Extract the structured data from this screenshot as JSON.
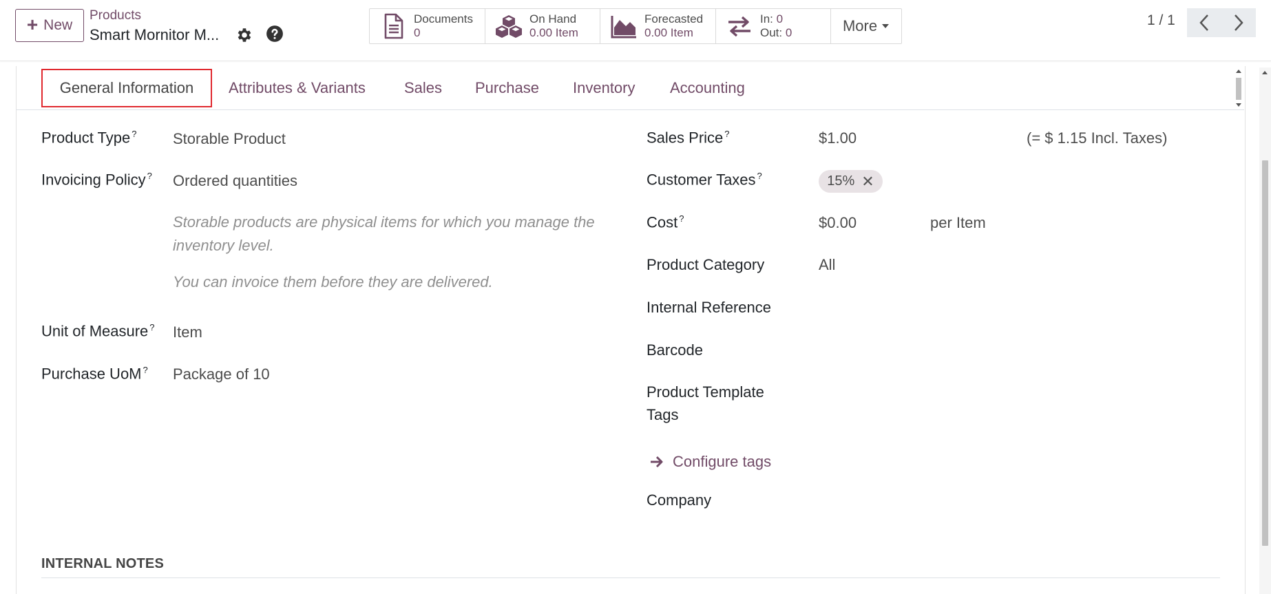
{
  "control_panel": {
    "new_label": "New",
    "breadcrumb_parent": "Products",
    "breadcrumb_current": "Smart Mornitor M...",
    "smart_buttons": {
      "documents": {
        "label": "Documents",
        "value": "0"
      },
      "on_hand": {
        "label": "On Hand",
        "value": "0.00 Item"
      },
      "forecasted": {
        "label": "Forecasted",
        "value": "0.00 Item"
      },
      "in_label": "In:",
      "in_value": "0",
      "out_label": "Out:",
      "out_value": "0",
      "more_label": "More"
    },
    "pager": "1 / 1"
  },
  "tabs": [
    "General Information",
    "Attributes & Variants",
    "Sales",
    "Purchase",
    "Inventory",
    "Accounting"
  ],
  "left_fields": {
    "product_type": {
      "label": "Product Type",
      "value": "Storable Product"
    },
    "invoicing_policy": {
      "label": "Invoicing Policy",
      "value": "Ordered quantities"
    },
    "help_1": "Storable products are physical items for which you manage the inventory level.",
    "help_2": "You can invoice them before they are delivered.",
    "uom": {
      "label": "Unit of Measure",
      "value": "Item"
    },
    "purchase_uom": {
      "label": "Purchase UoM",
      "value": "Package of 10"
    }
  },
  "right_fields": {
    "sales_price": {
      "label": "Sales Price",
      "value": "$1.00",
      "incl_taxes": "(= $ 1.15 Incl. Taxes)"
    },
    "customer_taxes": {
      "label": "Customer Taxes",
      "tag": "15%"
    },
    "cost": {
      "label": "Cost",
      "value": "$0.00",
      "unit": "per Item"
    },
    "product_category": {
      "label": "Product Category",
      "value": "All"
    },
    "internal_reference": {
      "label": "Internal Reference"
    },
    "barcode": {
      "label": "Barcode"
    },
    "template_tags": {
      "label_line1": "Product Template",
      "label_line2": "Tags"
    },
    "configure_tags": "Configure tags",
    "company": {
      "label": "Company"
    }
  },
  "internal_notes_title": "INTERNAL NOTES",
  "colors": {
    "brand": "#714b67",
    "active_tab_border": "#e0282e"
  }
}
